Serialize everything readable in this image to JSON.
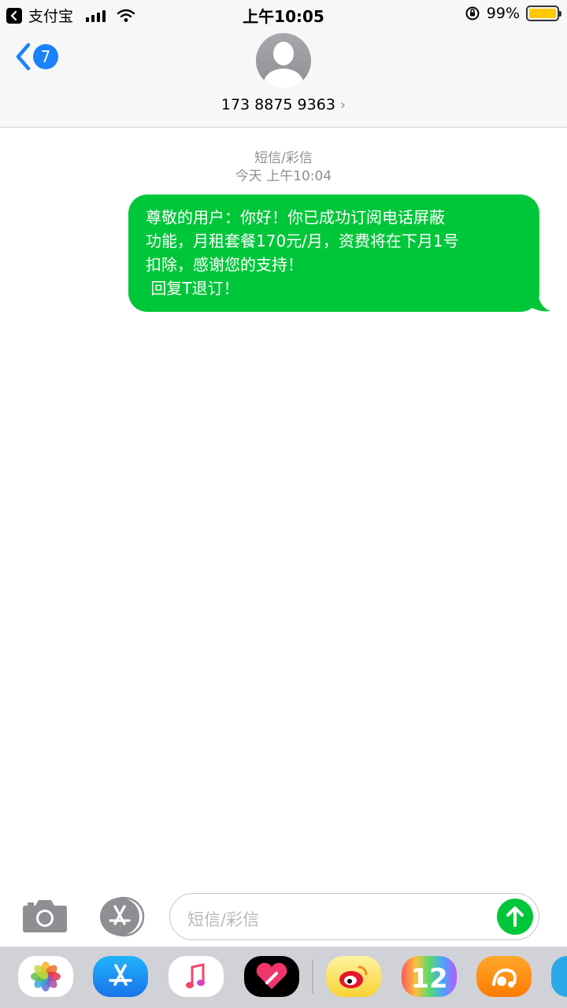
{
  "status_bar": {
    "back_app": "支付宝",
    "time": "上午10:05",
    "battery_percent": "99%",
    "battery_level": 0.99
  },
  "nav": {
    "back_badge": "7",
    "contact": "173 8875 9363"
  },
  "conversation": {
    "service_label": "短信/彩信",
    "timestamp": "今天 上午10:04",
    "message_lines": [
      "尊敬的用户：你好！你已成功订阅电话屏蔽",
      "功能，月租套餐170元/月，资费将在下月1号",
      "扣除，感谢您的支持！",
      " 回复T退订！"
    ]
  },
  "input": {
    "placeholder": "短信/彩信"
  },
  "app_strip": {
    "apps": [
      "photos-icon",
      "app-store-icon",
      "music-icon",
      "digital-touch-icon",
      "weibo-icon",
      "ios12-icon",
      "uc-browser-icon",
      "partial-app-icon"
    ],
    "weibo_text": "",
    "ios12_label": "12"
  },
  "colors": {
    "bubble": "#00c63a",
    "accent_blue": "#1a82fb",
    "header_bg": "#f7f7f7",
    "strip_bg": "#d1d2d7"
  }
}
